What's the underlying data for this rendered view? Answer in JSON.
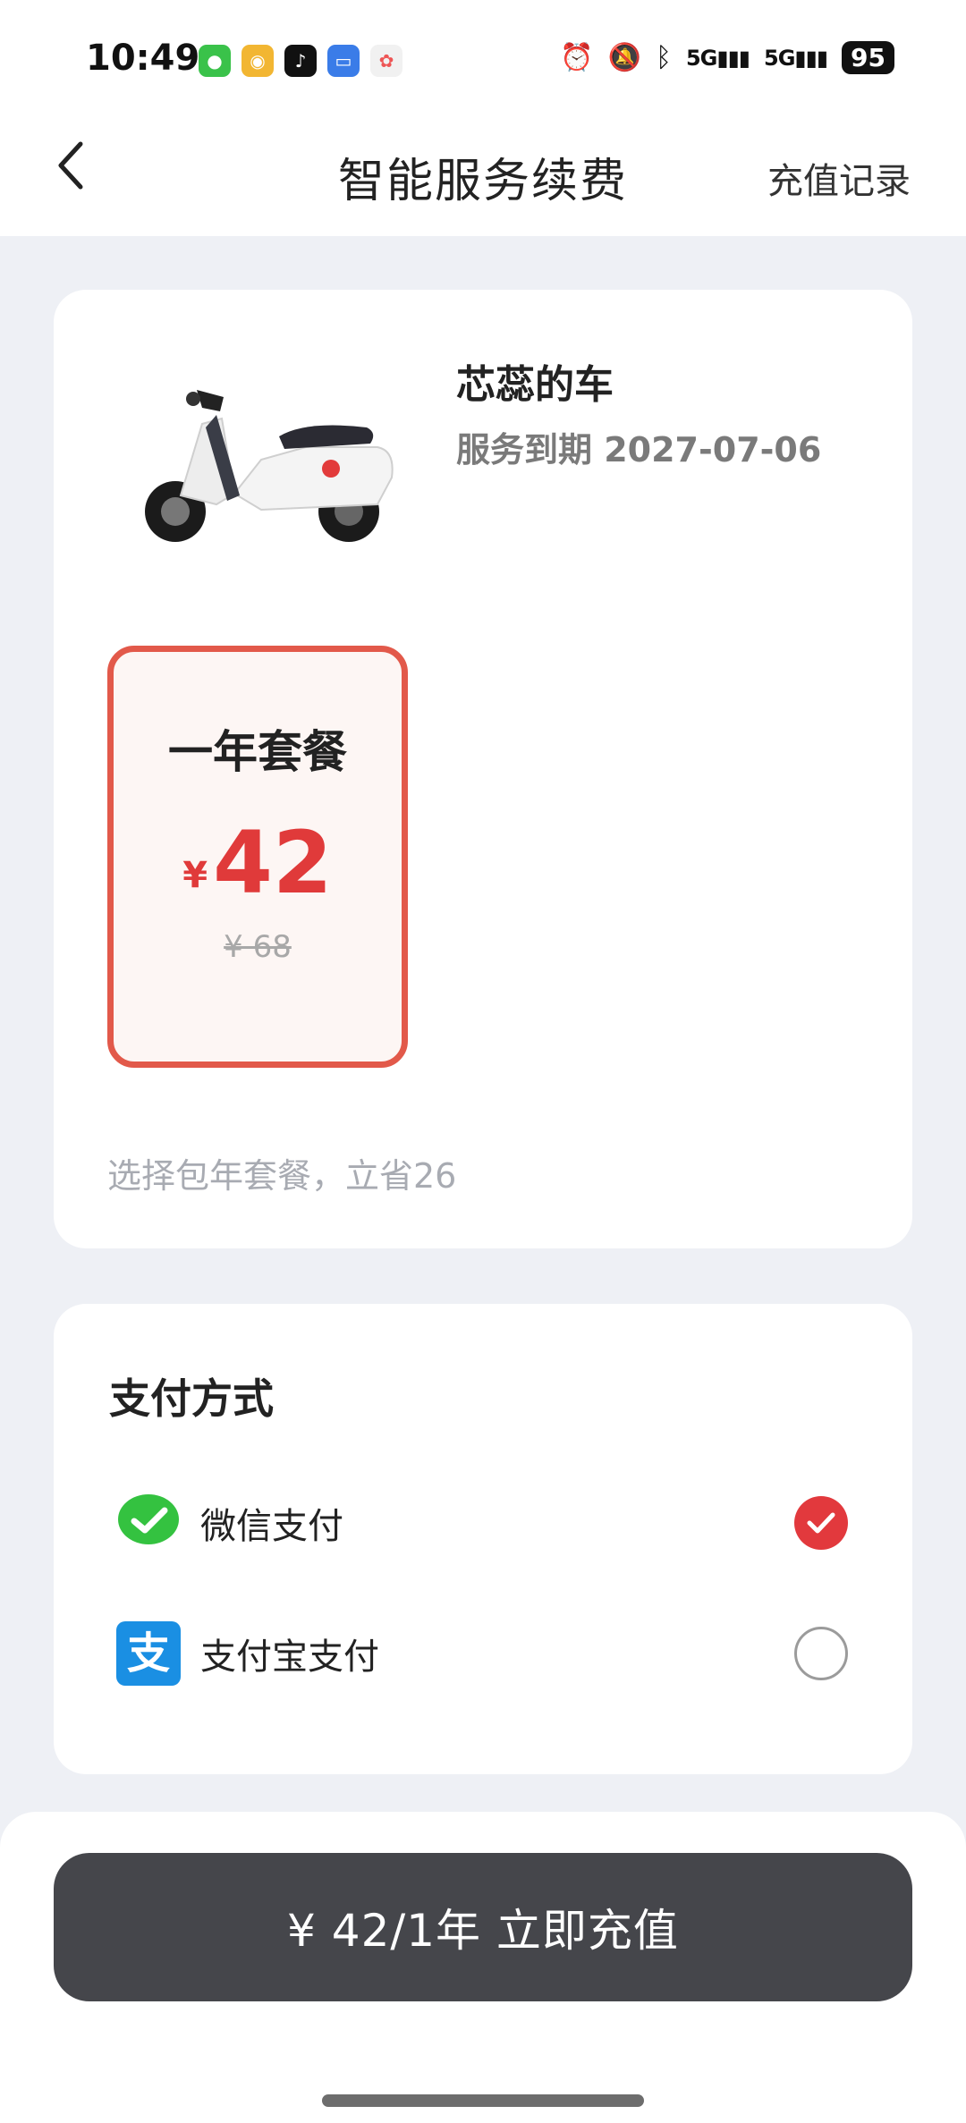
{
  "status_bar": {
    "time": "10:49",
    "apps": [
      "wechat",
      "weibo",
      "douyin",
      "files",
      "photos"
    ],
    "signal_1": "5G",
    "signal_2": "5G",
    "battery": "95"
  },
  "header": {
    "title": "智能服务续费",
    "record_link": "充值记录"
  },
  "vehicle": {
    "name": "芯蕊的车",
    "expiry": "服务到期 2027-07-06"
  },
  "plan": {
    "name": "一年套餐",
    "currency": "¥",
    "price": "42",
    "original_price": "¥ 68",
    "hint": "选择包年套餐，立省26"
  },
  "payment": {
    "title": "支付方式",
    "methods": [
      {
        "label": "微信支付",
        "selected": true
      },
      {
        "label": "支付宝支付",
        "selected": false
      }
    ]
  },
  "action": {
    "pay_label": "¥ 42/1年 立即充值"
  },
  "colors": {
    "accent": "#e2393d",
    "plan_border": "#e2594a",
    "button_bg": "#45464b",
    "wechat": "#34c240",
    "alipay": "#1a8fe3"
  }
}
